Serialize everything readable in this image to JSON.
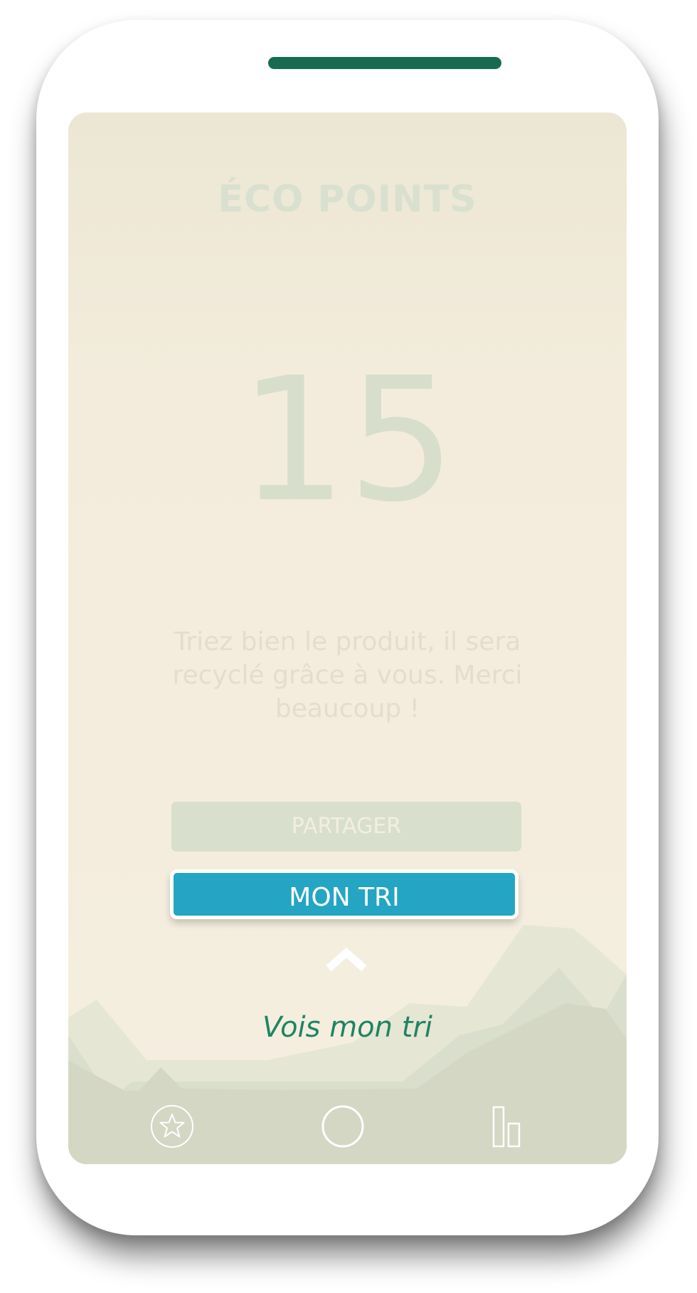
{
  "screen": {
    "title": "ÉCO POINTS",
    "points": "15",
    "message": "Triez bien le produit, il sera recyclé grâce à vous. Merci beaucoup !",
    "share_button": "PARTAGER",
    "primary_button": "MON TRI",
    "see_link": "Vois mon tri"
  },
  "nav": {
    "items": [
      {
        "icon": "star-icon"
      },
      {
        "icon": "circle-icon"
      },
      {
        "icon": "bar-chart-icon"
      }
    ]
  },
  "colors": {
    "accent_green": "#186b50",
    "link_green": "#1e8463",
    "button_blue": "#24a5c3",
    "background_cream": "#f5eee0",
    "muted_sage": "#d7dfcc"
  }
}
